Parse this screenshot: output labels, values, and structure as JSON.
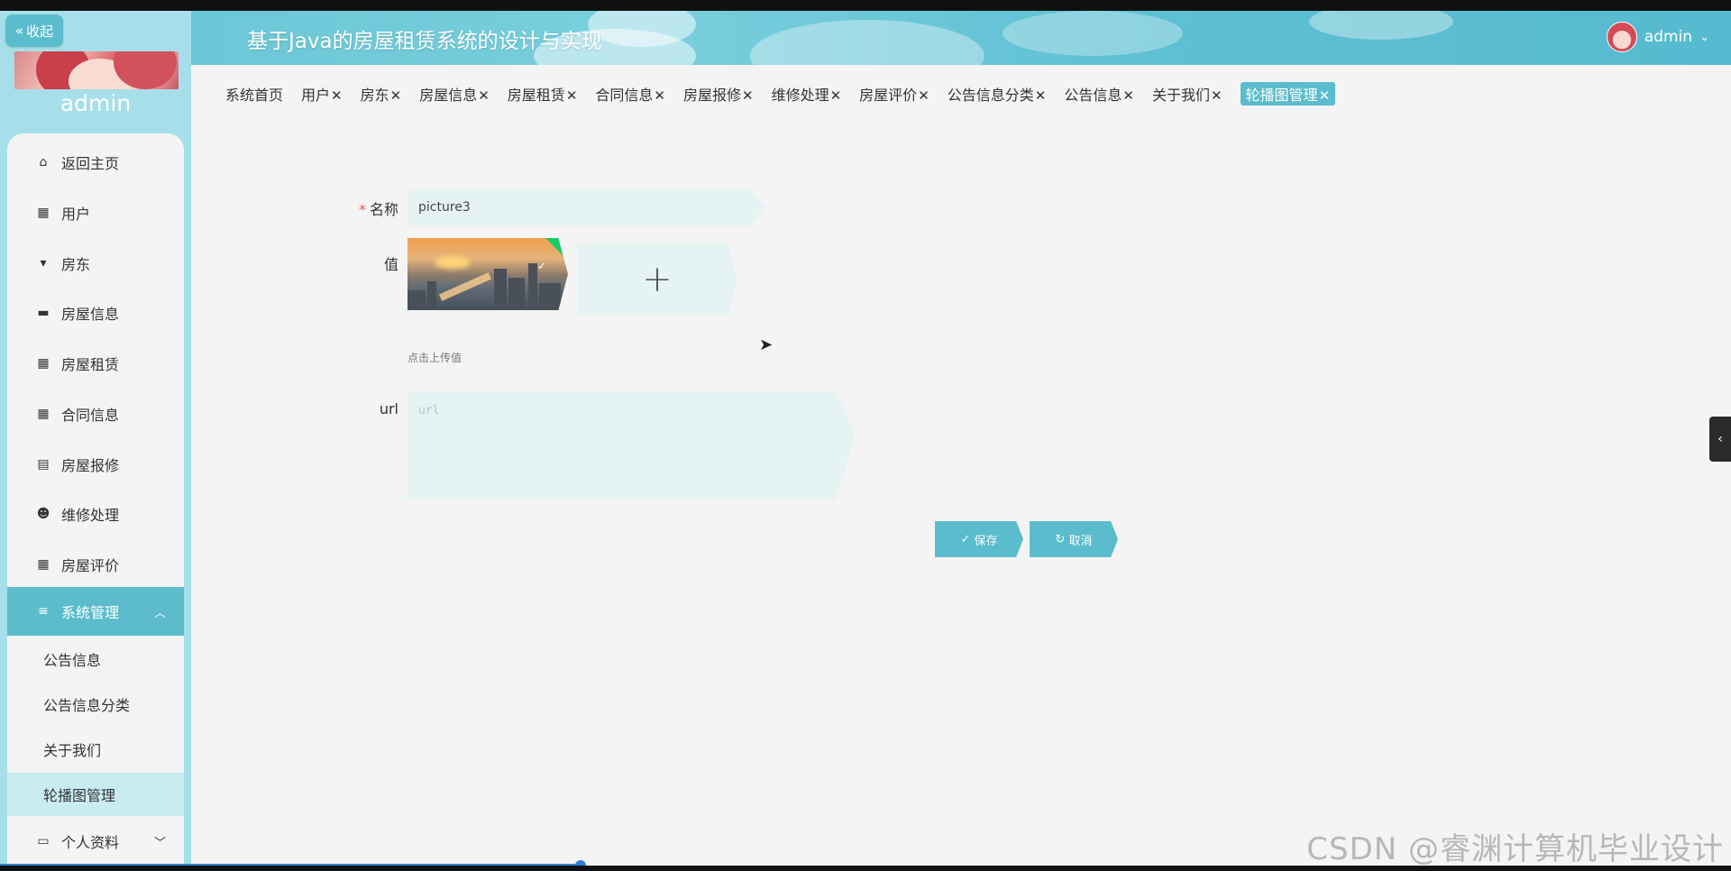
{
  "sidebar": {
    "collapse_label": "收起",
    "username": "admin",
    "menu": [
      {
        "label": "返回主页",
        "icon": "home-icon"
      },
      {
        "label": "用户",
        "icon": "grid-icon"
      },
      {
        "label": "房东",
        "icon": "flag-icon"
      },
      {
        "label": "房屋信息",
        "icon": "monitor-icon"
      },
      {
        "label": "房屋租赁",
        "icon": "grid-icon"
      },
      {
        "label": "合同信息",
        "icon": "grid-icon"
      },
      {
        "label": "房屋报修",
        "icon": "clipboard-icon"
      },
      {
        "label": "维修处理",
        "icon": "person-icon"
      },
      {
        "label": "房屋评价",
        "icon": "grid-icon"
      }
    ],
    "system_menu": {
      "label": "系统管理",
      "icon": "sliders-icon",
      "expanded": true
    },
    "submenu": [
      "公告信息",
      "公告信息分类",
      "关于我们",
      "轮播图管理"
    ],
    "selected_submenu": "轮播图管理",
    "profile": {
      "label": "个人资料",
      "icon": "card-icon"
    }
  },
  "header": {
    "title": "基于Java的房屋租赁系统的设计与实现",
    "user": "admin"
  },
  "tabs": [
    {
      "label": "系统首页",
      "closable": false
    },
    {
      "label": "用户",
      "closable": true
    },
    {
      "label": "房东",
      "closable": true
    },
    {
      "label": "房屋信息",
      "closable": true
    },
    {
      "label": "房屋租赁",
      "closable": true
    },
    {
      "label": "合同信息",
      "closable": true
    },
    {
      "label": "房屋报修",
      "closable": true
    },
    {
      "label": "维修处理",
      "closable": true
    },
    {
      "label": "房屋评价",
      "closable": true
    },
    {
      "label": "公告信息分类",
      "closable": true
    },
    {
      "label": "公告信息",
      "closable": true
    },
    {
      "label": "关于我们",
      "closable": true
    },
    {
      "label": "轮播图管理",
      "closable": true,
      "active": true
    }
  ],
  "form": {
    "name_label": "名称",
    "name_value": "picture3",
    "value_label": "值",
    "upload_hint": "点击上传值",
    "url_label": "url",
    "url_placeholder": "url",
    "save_label": "保存",
    "cancel_label": "取消"
  },
  "watermark": "CSDN @睿渊计算机毕业设计",
  "colors": {
    "accent": "#5bbccd",
    "sidebar": "#a6dfe9",
    "input_bg": "#e6f3f3"
  }
}
